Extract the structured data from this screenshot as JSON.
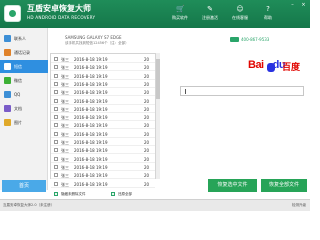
{
  "app": {
    "title": "互盾安卓恢复大师",
    "subtitle": "HD ANDROID DATA RECOVERY"
  },
  "top_buttons": [
    {
      "label": "购买软件",
      "icon": "cart-icon"
    },
    {
      "label": "注册激活",
      "icon": "register-icon"
    },
    {
      "label": "在线客服",
      "icon": "chat-icon"
    },
    {
      "label": "帮助",
      "icon": "help-icon"
    }
  ],
  "window_buttons": {
    "minimize": "–",
    "close": "×"
  },
  "sidebar": {
    "items": [
      {
        "label": "联系人",
        "icon": "contacts-icon",
        "color": "#3d8fd6",
        "active": false
      },
      {
        "label": "通话记录",
        "icon": "call-log-icon",
        "color": "#e0822a",
        "active": false
      },
      {
        "label": "短信",
        "icon": "sms-icon",
        "color": "#2f8fe0",
        "active": true
      },
      {
        "label": "微信",
        "icon": "wechat-icon",
        "color": "#3cb034",
        "active": false
      },
      {
        "label": "QQ",
        "icon": "qq-icon",
        "color": "#3d8fd6",
        "active": false
      },
      {
        "label": "文档",
        "icon": "document-icon",
        "color": "#7a5cc8",
        "active": false
      },
      {
        "label": "图片",
        "icon": "photo-icon",
        "color": "#e0a92a",
        "active": false
      }
    ],
    "back_label": "首页"
  },
  "device": {
    "name": "SAMSUNG GALAXY S7 EDGE",
    "info": "该手机共找到短信12456个（注：全部）",
    "phone": "400-867-9533"
  },
  "list": {
    "rows": [
      {
        "c1": "张三",
        "c2": "2016-8-18 19:19",
        "c3": "20"
      },
      {
        "c1": "张三",
        "c2": "2016-8-18 19:19",
        "c3": "20"
      },
      {
        "c1": "张三",
        "c2": "2016-8-18 19:19",
        "c3": "20"
      },
      {
        "c1": "张三",
        "c2": "2016-8-18 19:19",
        "c3": "20"
      },
      {
        "c1": "张三",
        "c2": "2016-8-18 19:19",
        "c3": "20"
      },
      {
        "c1": "张三",
        "c2": "2016-8-18 19:19",
        "c3": "20"
      },
      {
        "c1": "张三",
        "c2": "2016-8-18 19:19",
        "c3": "20"
      },
      {
        "c1": "张三",
        "c2": "2016-8-18 19:19",
        "c3": "20"
      },
      {
        "c1": "张三",
        "c2": "2016-8-18 19:19",
        "c3": "20"
      },
      {
        "c1": "张三",
        "c2": "2016-8-18 19:19",
        "c3": "20"
      },
      {
        "c1": "张三",
        "c2": "2016-8-18 19:19",
        "c3": "20"
      },
      {
        "c1": "张三",
        "c2": "2016-8-18 19:19",
        "c3": "20"
      },
      {
        "c1": "张三",
        "c2": "2016-8-18 19:19",
        "c3": "20"
      },
      {
        "c1": "张三",
        "c2": "2016-8-18 19:19",
        "c3": "20"
      },
      {
        "c1": "张三",
        "c2": "2016-8-18 19:19",
        "c3": "20"
      },
      {
        "c1": "张三",
        "c2": "2016-8-18 19:19",
        "c3": "20"
      }
    ],
    "footer_left": "隐藏未删除文件",
    "footer_right": "还原全部"
  },
  "browser": {
    "logo_bai": "Bai",
    "logo_du": "du",
    "logo_cn": "百度"
  },
  "actions": {
    "recover_selected": "恢复选中文件",
    "recover_all": "恢复全部文件"
  },
  "status": {
    "left": "互盾安卓恢复大师2.0（未注册）",
    "right": "检测升级"
  }
}
